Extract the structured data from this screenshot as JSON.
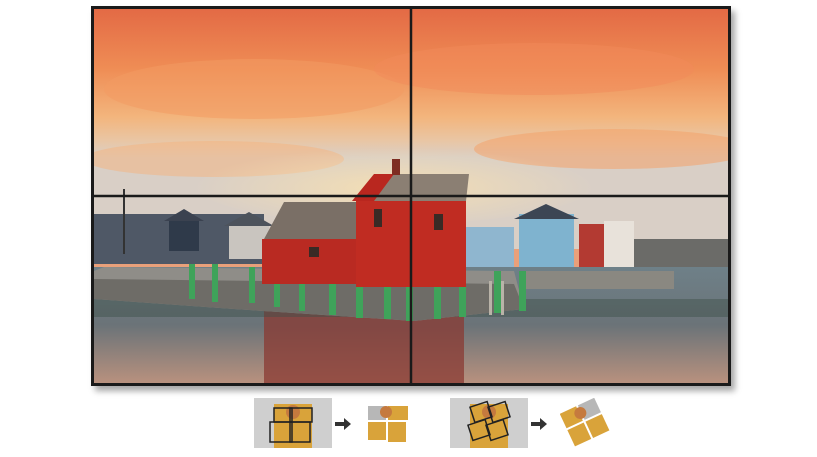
{
  "video_wall": {
    "layout": "2x2",
    "scene": "red-fishing-shack-harbor-sunset"
  },
  "transform_examples": [
    {
      "name": "bezel-overlap-to-aligned",
      "icon": "arrow-right-icon"
    },
    {
      "name": "rotation-to-aligned",
      "icon": "arrow-right-icon"
    }
  ],
  "colors": {
    "bezel": "#1a1a1a",
    "sky_top": "#e8774a",
    "shack_red": "#b92a22",
    "water": "#5c6f78"
  }
}
